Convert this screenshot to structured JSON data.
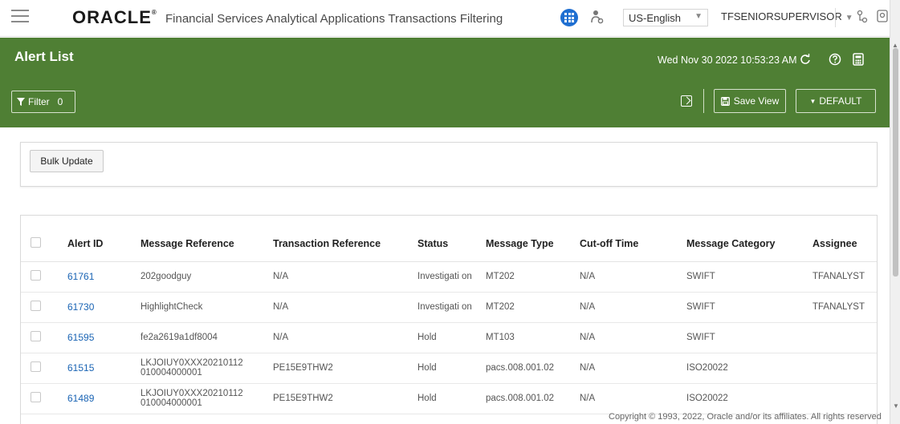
{
  "header": {
    "brand": "ORACLE",
    "app_title": "Financial Services Analytical Applications Transactions Filtering",
    "language": "US-English",
    "user": "TFSENIORSUPERVISOR"
  },
  "page": {
    "title": "Alert List",
    "datetime": "Wed Nov 30 2022 10:53:23 AM",
    "filter_label": "Filter",
    "filter_count": "0",
    "save_view_label": "Save View",
    "default_label": "DEFAULT",
    "bulk_update_label": "Bulk Update",
    "copyright": "Copyright © 1993, 2022, Oracle and/or its affiliates. All rights reserved"
  },
  "table": {
    "headers": [
      "Alert ID",
      "Message Reference",
      "Transaction Reference",
      "Status",
      "Message Type",
      "Cut-off Time",
      "Message Category",
      "Assignee"
    ],
    "rows": [
      {
        "alert_id": "61761",
        "message_reference": "202goodguy",
        "transaction_reference": "N/A",
        "status": "Investigati on",
        "message_type": "MT202",
        "cutoff_time": "N/A",
        "message_category": "SWIFT",
        "assignee": "TFANALYST"
      },
      {
        "alert_id": "61730",
        "message_reference": "HighlightCheck",
        "transaction_reference": "N/A",
        "status": "Investigati on",
        "message_type": "MT202",
        "cutoff_time": "N/A",
        "message_category": "SWIFT",
        "assignee": "TFANALYST"
      },
      {
        "alert_id": "61595",
        "message_reference": "fe2a2619a1df8004",
        "transaction_reference": "N/A",
        "status": "Hold",
        "message_type": "MT103",
        "cutoff_time": "N/A",
        "message_category": "SWIFT",
        "assignee": ""
      },
      {
        "alert_id": "61515",
        "message_reference": "LKJOIUY0XXX20210112 010004000001",
        "transaction_reference": "PE15E9THW2",
        "status": "Hold",
        "message_type": "pacs.008.001.02",
        "cutoff_time": "N/A",
        "message_category": "ISO20022",
        "assignee": ""
      },
      {
        "alert_id": "61489",
        "message_reference": "LKJOIUY0XXX20210112 010004000001",
        "transaction_reference": "PE15E9THW2",
        "status": "Hold",
        "message_type": "pacs.008.001.02",
        "cutoff_time": "N/A",
        "message_category": "ISO20022",
        "assignee": ""
      }
    ]
  },
  "colors": {
    "band": "#4f7f34",
    "link": "#1a64b4",
    "apps_button": "#1f6fd1"
  },
  "icons": [
    "hamburger-menu-icon",
    "apps-grid-icon",
    "person-tool-icon",
    "org-chart-icon",
    "profile-icon",
    "refresh-icon",
    "help-icon",
    "calculator-icon",
    "filter-icon",
    "expand-icon",
    "save-icon",
    "caret-down-icon"
  ]
}
